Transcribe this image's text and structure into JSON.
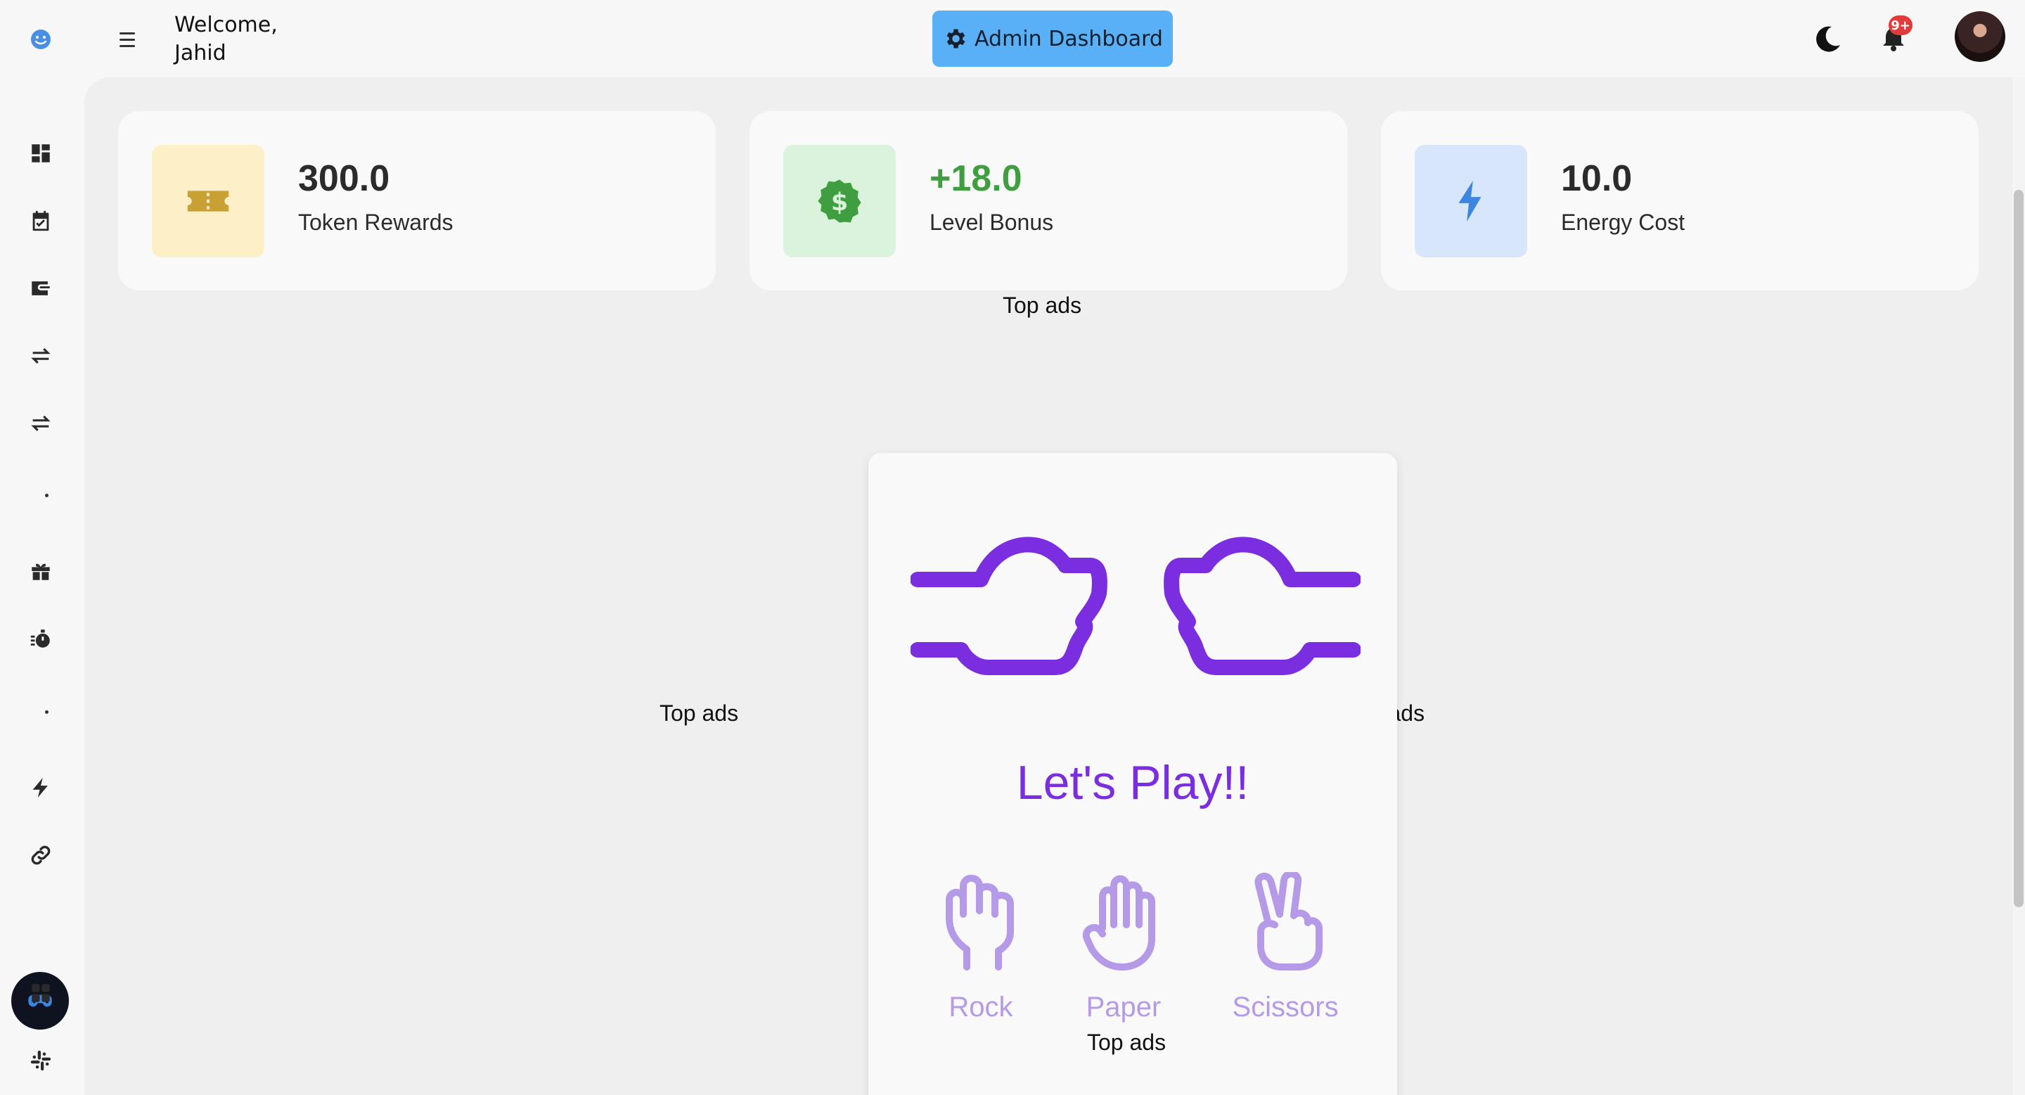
{
  "header": {
    "welcome_line1": "Welcome,",
    "welcome_line2": "Jahid",
    "admin_button": "Admin Dashboard",
    "notification_badge": "9+"
  },
  "stats": [
    {
      "value": "300.0",
      "label": "Token Rewards",
      "icon": "ticket-icon",
      "tile_color": "#fdefc6",
      "icon_color": "#c8a034",
      "value_color": "#2b2b2b"
    },
    {
      "value": "+18.0",
      "label": "Level Bonus",
      "icon": "dollar-badge-icon",
      "tile_color": "#dbf2dd",
      "icon_color": "#3f9e3f",
      "value_color": "#3f9e3f"
    },
    {
      "value": "10.0",
      "label": "Energy Cost",
      "icon": "lightning-icon",
      "tile_color": "#d7e6fb",
      "icon_color": "#3d86e0",
      "value_color": "#2b2b2b"
    }
  ],
  "ads": {
    "top": "Top ads",
    "left": "Top ads",
    "right": "Top ads",
    "bottom": "Top ads"
  },
  "game": {
    "title": "Let's Play!!",
    "choices": [
      "Rock",
      "Paper",
      "Scissors"
    ],
    "accent_color": "#7b2ee0",
    "choice_color": "#b59ae8"
  },
  "sidebar_icons": [
    "dashboard-icon",
    "calendar-check-icon",
    "wallet-icon",
    "swap-icon",
    "swap-icon",
    "gift-icon",
    "stopwatch-icon",
    "lightning-icon",
    "link-icon",
    "gamepad-icon",
    "apps-icon",
    "slack-icon"
  ]
}
